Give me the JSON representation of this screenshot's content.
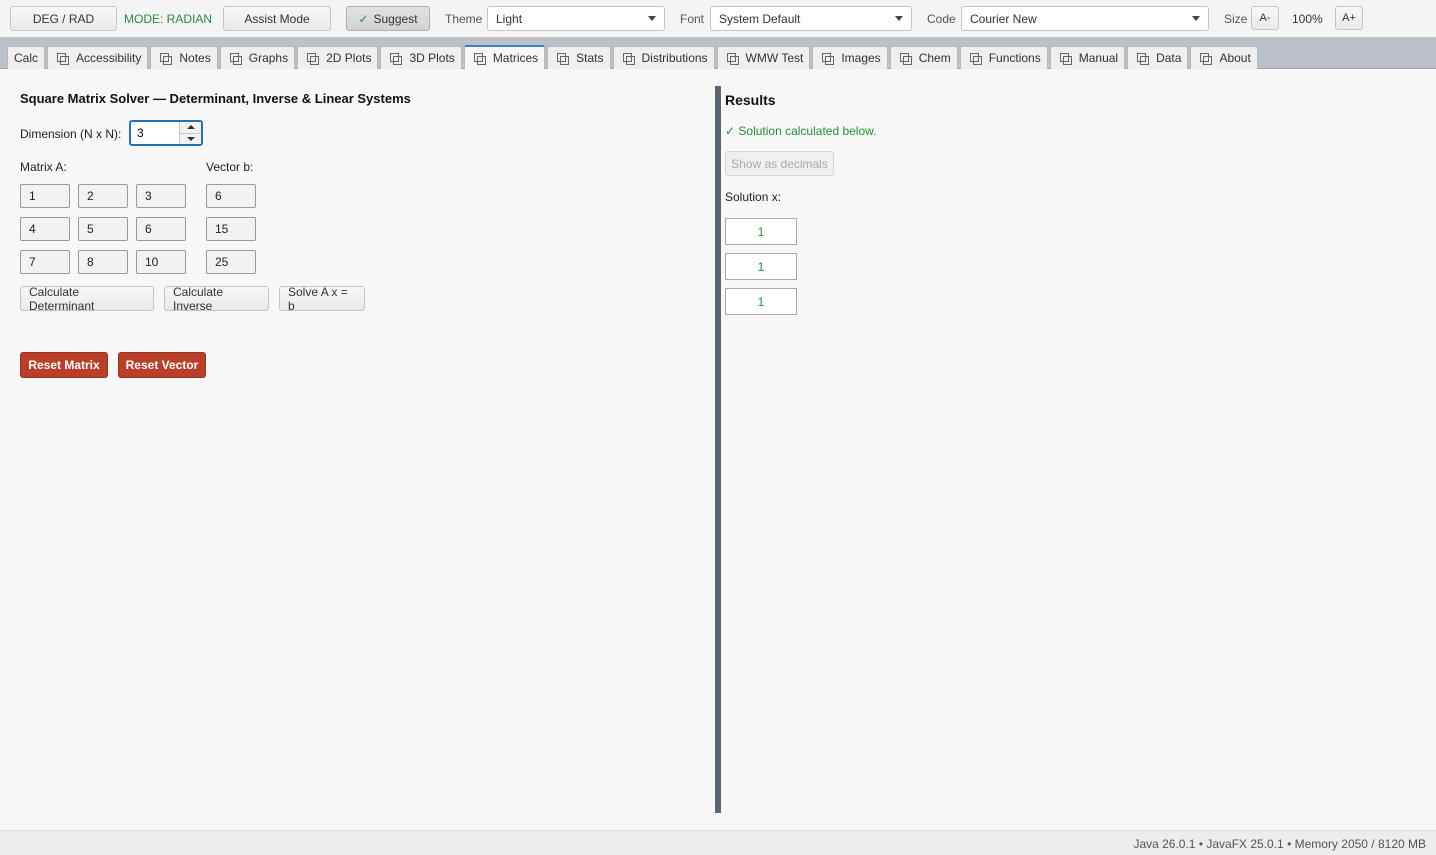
{
  "toolbar": {
    "deg_rad_label": "DEG / RAD",
    "mode_label": "MODE: RADIAN",
    "assist_label": "Assist Mode",
    "suggest_check": "✓",
    "suggest_label": "Suggest",
    "theme_label": "Theme",
    "theme_value": "Light",
    "font_label": "Font",
    "font_value": "System Default",
    "code_label": "Code",
    "code_value": "Courier New",
    "size_label": "Size",
    "size_dec": "A-",
    "size_value": "100%",
    "size_inc": "A+"
  },
  "tabs": [
    "Calc",
    "Accessibility",
    "Notes",
    "Graphs",
    "2D Plots",
    "3D Plots",
    "Matrices",
    "Stats",
    "Distributions",
    "WMW Test",
    "Images",
    "Chem",
    "Functions",
    "Manual",
    "Data",
    "About"
  ],
  "active_tab": "Matrices",
  "solver": {
    "title": "Square Matrix Solver — Determinant, Inverse & Linear Systems",
    "dimension_label": "Dimension (N x N):",
    "dimension_value": "3",
    "matrix_label": "Matrix A:",
    "vector_label": "Vector b:",
    "matrix": [
      [
        "1",
        "2",
        "3"
      ],
      [
        "4",
        "5",
        "6"
      ],
      [
        "7",
        "8",
        "10"
      ]
    ],
    "vector": [
      "6",
      "15",
      "25"
    ],
    "determinant_button": "Calculate Determinant",
    "inverse_button": "Calculate Inverse",
    "solve_button": "Solve A x = b",
    "reset_matrix_button": "Reset Matrix",
    "reset_vector_button": "Reset Vector"
  },
  "results": {
    "title": "Results",
    "status": "✓  Solution calculated below.",
    "decimals_button": "Show as decimals",
    "solution_label": "Solution x:",
    "solution": [
      "1",
      "1",
      "1"
    ]
  },
  "status_bar": {
    "text": "Java 26.0.1  •  JavaFX 25.0.1  •  Memory 2050 / 8120 MB"
  },
  "colors": {
    "accent": "#2b6fb3",
    "success": "#2a8a3a",
    "danger": "#b8402b",
    "divider": "#5c6570"
  }
}
